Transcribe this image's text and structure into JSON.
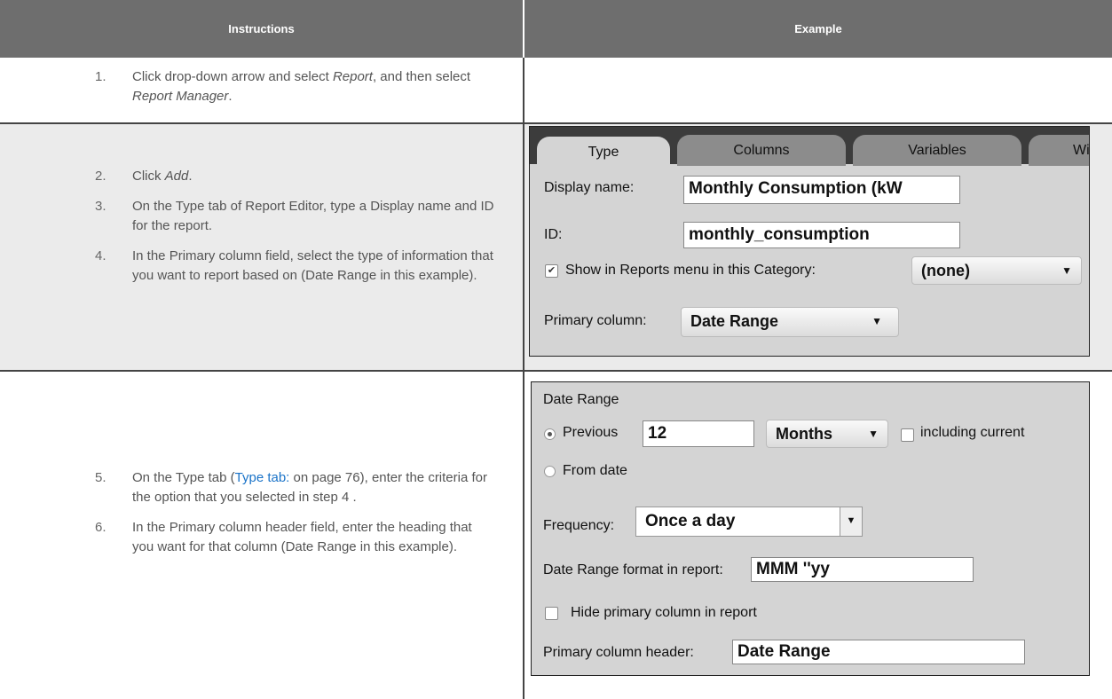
{
  "table": {
    "header_left": "Instructions",
    "header_right": "Example"
  },
  "steps": [
    {
      "num": "1.",
      "pre": "Click drop-down arrow and select ",
      "i1": "Report",
      "mid": ", and then select ",
      "i2": "Report Manager",
      "post": "."
    },
    {
      "num": "2.",
      "pre": "Click ",
      "i1": "Add",
      "post": "."
    },
    {
      "num": "3.",
      "text": "On the Type tab of Report Editor, type a Display name and ID for the report."
    },
    {
      "num": "4.",
      "text": "In the Primary column field, select the type of information that you want to report based on (Date Range in this example)."
    },
    {
      "num": "5.",
      "pre": "On the Type tab (",
      "link": "Type tab:",
      "link2": " on page 76",
      "post": "), enter the criteria for the option that you selected in step  4 ."
    },
    {
      "num": "6.",
      "text": "In the Primary column header field, enter the heading that you want for that column (Date Range in this example)."
    }
  ],
  "shot1": {
    "tabs": [
      "Type",
      "Columns",
      "Variables",
      "Wi"
    ],
    "display_name_label": "Display name:",
    "display_name_value": "Monthly Consumption (kW",
    "id_label": "ID:",
    "id_value": "monthly_consumption",
    "show_in_menu_label": "Show in Reports menu in this Category:",
    "show_in_menu_checked": true,
    "category_value": "(none)",
    "primary_column_label": "Primary column:",
    "primary_column_value": "Date Range"
  },
  "shot2": {
    "section_title": "Date Range",
    "previous_label": "Previous",
    "previous_value": "12",
    "units_value": "Months",
    "including_current_label": "including current",
    "from_date_label": "From date",
    "frequency_label": "Frequency:",
    "frequency_value": "Once a day",
    "format_label": "Date Range format in report:",
    "format_value": "MMM ''yy",
    "hide_primary_label": "Hide primary column in report",
    "primary_header_label": "Primary column header:",
    "primary_header_value": "Date Range"
  },
  "icons": {
    "dropdown_arrow": "▼",
    "check": "✔"
  }
}
